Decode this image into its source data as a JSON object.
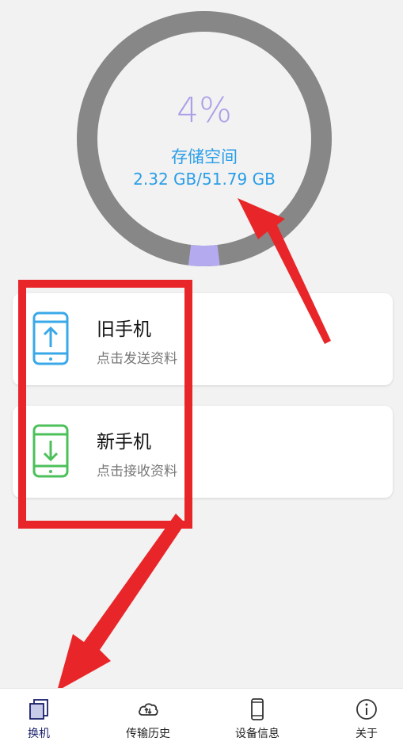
{
  "storage": {
    "percent": "4%",
    "label": "存储空间",
    "value": "2.32 GB/51.79 GB",
    "used_fraction": 0.04
  },
  "cards": [
    {
      "title": "旧手机",
      "subtitle": "点击发送资料",
      "icon": "phone-upload-icon",
      "color": "#3aa8e8"
    },
    {
      "title": "新手机",
      "subtitle": "点击接收资料",
      "icon": "phone-download-icon",
      "color": "#4cc05a"
    }
  ],
  "tabs": [
    {
      "label": "换机",
      "icon": "switch-device-icon",
      "active": true
    },
    {
      "label": "传输历史",
      "icon": "cloud-transfer-icon",
      "active": false
    },
    {
      "label": "设备信息",
      "icon": "phone-icon",
      "active": false
    },
    {
      "label": "关于",
      "icon": "info-icon",
      "active": false
    }
  ],
  "colors": {
    "ring_track": "#878787",
    "ring_used": "#b3aaf0",
    "annotation": "#e8262a",
    "accent_blue": "#2a9ee8"
  }
}
